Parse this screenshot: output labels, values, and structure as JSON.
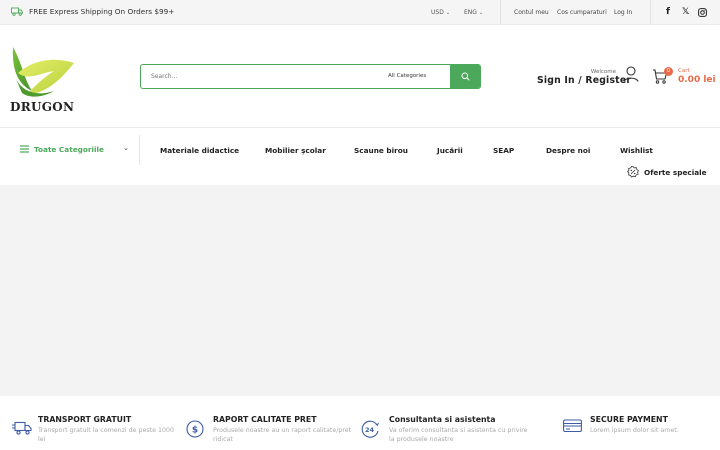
{
  "topbar": {
    "shipping_text": "FREE Express Shipping On Orders $99+",
    "currency": "USD",
    "language": "ENG",
    "links": [
      "Contul meu",
      "Cos cumparaturi",
      "Log In"
    ]
  },
  "header": {
    "logo_text": "DRUGON",
    "search_placeholder": "Search...",
    "search_category": "All Categories",
    "welcome": "Welcome",
    "signin": "Sign In / Register",
    "cart_count": "0",
    "cart_label": "Cart",
    "cart_total": "0.00 lei"
  },
  "nav": {
    "categories_label": "Toate Categoriile",
    "items": [
      "Materiale didactice",
      "Mobilier școlar",
      "Scaune birou",
      "Jucării",
      "SEAP",
      "Despre noi",
      "Wishlist"
    ],
    "offers": "Oferte speciale"
  },
  "features": [
    {
      "title": "TRANSPORT GRATUIT",
      "desc1": "Transport gratuit la comenzi de peste 1000",
      "desc2": "lei",
      "icon": "truck-icon"
    },
    {
      "title": "RAPORT CALITATE PRET",
      "desc1": "Produsele noastre au un raport calitate/pret",
      "desc2": "ridicat",
      "icon": "dollar-coin-icon"
    },
    {
      "title": "Consultanta si asistenta",
      "desc1": "Va oferim consultanta si asistenta cu privire",
      "desc2": "la produsele noastre",
      "icon": "support-24-icon"
    },
    {
      "title": "SECURE PAYMENT",
      "desc1": "Lorem ipsum dolor sit amet.",
      "desc2": "",
      "icon": "credit-card-icon"
    }
  ],
  "colors": {
    "accent": "#4ca85b",
    "cart": "#e96a4a"
  }
}
